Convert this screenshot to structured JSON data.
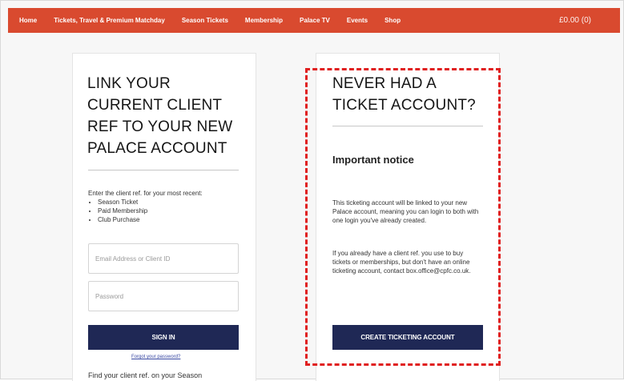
{
  "nav": {
    "links": [
      "Home",
      "Tickets, Travel & Premium Matchday",
      "Season Tickets",
      "Membership",
      "Palace TV",
      "Events",
      "Shop"
    ],
    "basket": "£0.00 (0)"
  },
  "link_account": {
    "title_lines": [
      "LINK YOUR",
      "CURRENT CLIENT",
      "REF TO YOUR NEW",
      "PALACE ACCOUNT"
    ],
    "instructions": "Enter the client ref. for your most recent:",
    "bullets": [
      "Season Ticket",
      "Paid Membership",
      "Club Purchase"
    ],
    "email_placeholder": "Email Address or Client ID",
    "password_placeholder": "Password",
    "sign_in_label": "SIGN IN",
    "forgot_label": "Forgot your password?",
    "find_ref_text": "Find your client ref. on your Season"
  },
  "new_account": {
    "title_lines": [
      "NEVER HAD A",
      "TICKET ACCOUNT?"
    ],
    "notice_heading": "Important notice",
    "paragraph1": "This ticketing account will be linked to your new Palace account, meaning you can login to both with one login you've already created.",
    "paragraph2": "If you already have a client ref. you use to buy tickets or memberships, but don't have an online ticketing account, contact box.office@cpfc.co.uk.",
    "create_label": "CREATE TICKETING ACCOUNT"
  },
  "colors": {
    "nav_bg": "#d94a2f",
    "button_bg": "#1f2855",
    "highlight": "#e02020"
  }
}
